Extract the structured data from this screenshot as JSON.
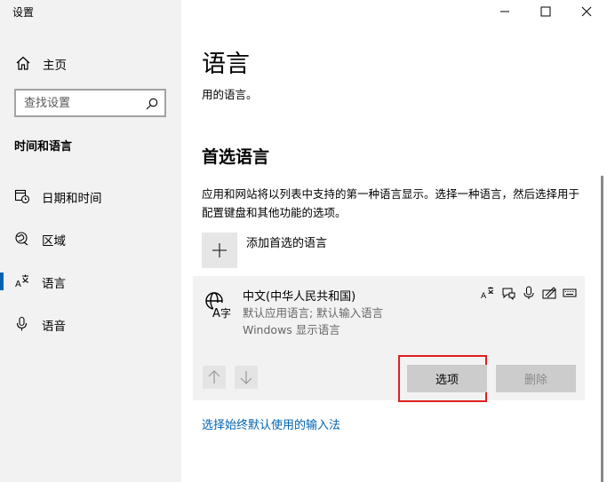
{
  "window": {
    "app_title": "设置",
    "minimize_icon": "minimize-icon",
    "maximize_icon": "maximize-icon",
    "close_icon": "close-icon"
  },
  "sidebar": {
    "home": {
      "icon": "home-icon",
      "label": "主页"
    },
    "search": {
      "placeholder": "查找设置",
      "value": "",
      "icon": "search-icon"
    },
    "section_title": "时间和语言",
    "items": [
      {
        "icon": "calendar-clock-icon",
        "label": "日期和时间",
        "selected": false
      },
      {
        "icon": "region-globe-icon",
        "label": "区域",
        "selected": false
      },
      {
        "icon": "language-icon",
        "label": "语言",
        "selected": true
      },
      {
        "icon": "microphone-icon",
        "label": "语音",
        "selected": false
      }
    ],
    "accent_color": "#0063b1"
  },
  "main": {
    "title": "语言",
    "subtitle": "用的语言。",
    "preferred_heading": "首选语言",
    "description": "应用和网站将以列表中支持的第一种语言显示。选择一种语言，然后选择用于配置键盘和其他功能的选项。",
    "add_button": {
      "icon": "plus-icon",
      "label": "添加首选的语言"
    },
    "language": {
      "icon": "language-display-icon",
      "name": "中文(中华人民共和国)",
      "line2": "默认应用语言; 默认输入语言",
      "line3": "Windows 显示语言",
      "feature_icons": [
        "display-language-icon",
        "speech-bubble-icon",
        "microphone-icon",
        "handwriting-icon",
        "keyboard-icon"
      ],
      "move_up_icon": "arrow-up-icon",
      "move_down_icon": "arrow-down-icon",
      "options_label": "选项",
      "delete_label": "删除"
    },
    "input_method_link": "选择始终默认使用的输入法",
    "highlight_color": "#e02020"
  }
}
